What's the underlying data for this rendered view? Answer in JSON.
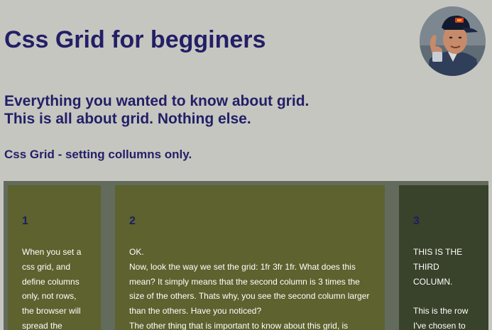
{
  "header": {
    "title": "Css Grid for begginers",
    "subtitle_line1": "Everything you wanted to know about grid.",
    "subtitle_line2": "This is all about grid. Nothing else.",
    "section_heading": "Css Grid - setting collumns only."
  },
  "grid": {
    "columns": [
      {
        "number": "1",
        "text": "When you set a css grid, and define columns only, not rows, the browser will spread the"
      },
      {
        "number": "2",
        "text": "OK.\nNow, look the way we set the grid: 1fr 3fr 1fr. What does this mean? It simply means that the second column is 3 times the size of the others. Thats why, you see the second column larger than the others. Have you noticed?\nThe other thing that is important to know about this grid, is"
      },
      {
        "number": "3",
        "text": "THIS IS THE THIRD COLUMN.\n\nThis is the row I've chosen to"
      }
    ]
  },
  "colors": {
    "page_background": "#c6c6c1",
    "heading": "#221f66",
    "grid_background": "#636b5c",
    "column_olive": "#5d622e",
    "column_dark": "#39422a"
  }
}
